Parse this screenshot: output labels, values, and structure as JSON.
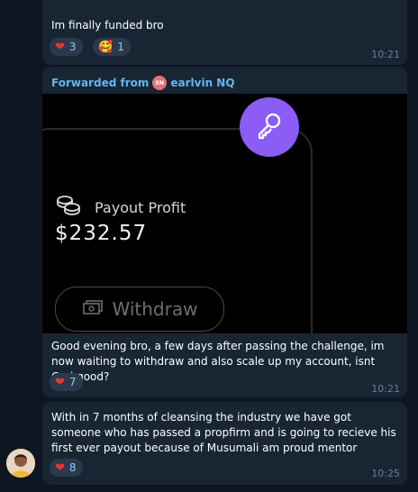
{
  "messages": [
    {
      "text": "Im finally funded bro",
      "time": "10:21",
      "reactions": [
        {
          "icon": "heart-icon",
          "count": "3"
        },
        {
          "icon": "hug-face-icon",
          "count": "1"
        }
      ]
    },
    {
      "forwarded_prefix": "Forwarded from",
      "forwarded_name": "earlvin NQ",
      "forwarded_avatar_initials": "EN",
      "image": {
        "payout_label": "Payout Profit",
        "amount": "$232.57",
        "withdraw_label": "Withdraw"
      },
      "text": "Good evening bro, a few days after passing the challenge, im now waiting to withdraw and also scale up my account, isnt God good?",
      "time": "10:21",
      "reactions": [
        {
          "icon": "heart-icon",
          "count": "7"
        }
      ]
    },
    {
      "text": "With in 7 months of cleansing the industry we have got someone who has passed a propfirm and is going to recieve his first ever payout because of Musumali am proud mentor",
      "time": "10:25",
      "reactions": [
        {
          "icon": "heart-icon",
          "count": "8"
        }
      ]
    }
  ],
  "colors": {
    "background": "#0e1621",
    "bubble": "#182533",
    "link": "#64b5ef",
    "accent_purple": "#8b5cf6",
    "heart": "#e53935"
  }
}
